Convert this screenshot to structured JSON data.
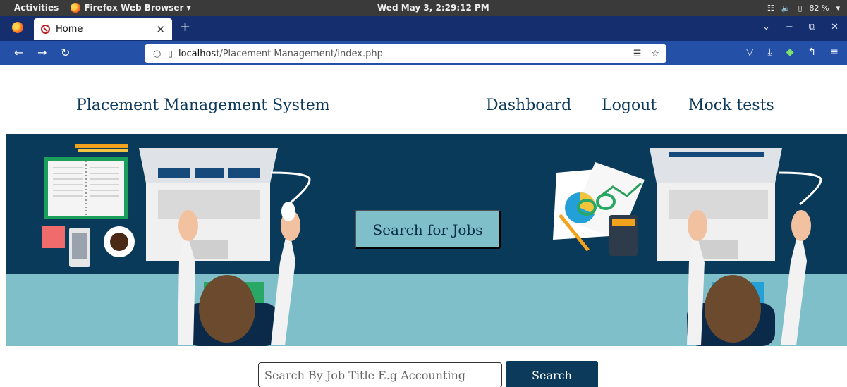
{
  "os_bar": {
    "activities": "Activities",
    "app_name": "Firefox Web Browser ▾",
    "clock": "Wed May  3, 2:29:12 PM",
    "battery": "82 %"
  },
  "browser": {
    "tab_title": "Home",
    "url_host": "localhost",
    "url_path": "/Placement Management/index.php"
  },
  "site": {
    "brand": "Placement Management System",
    "nav": [
      "Dashboard",
      "Logout",
      "Mock tests"
    ],
    "hero_button": "Search for Jobs",
    "search_placeholder": "Search By Job Title E.g Accounting",
    "search_button": "Search"
  },
  "colors": {
    "navy": "#0a3a5a",
    "teal": "#7fbfca",
    "button": "#0c3a5b"
  }
}
